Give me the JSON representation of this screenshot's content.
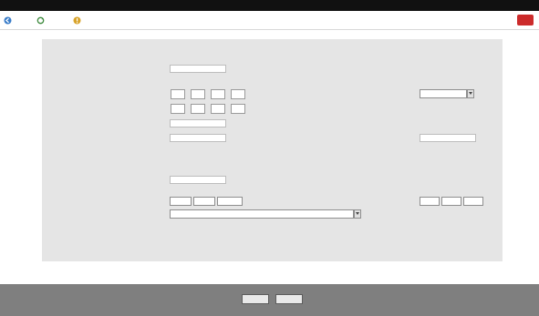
{
  "window": {
    "title": ""
  },
  "toolbar": {
    "items": [
      {
        "label": "",
        "icon": "back-icon"
      },
      {
        "label": "",
        "icon": "refresh-icon"
      },
      {
        "label": "",
        "icon": "help-icon"
      }
    ],
    "brand_color": "#cc2b2b"
  },
  "form": {
    "section1": {
      "title": "",
      "row1": {
        "label": "",
        "value": ""
      },
      "row2": {
        "label": "",
        "value": ""
      },
      "row3": {
        "label": "",
        "right_label": "",
        "right_value": ""
      },
      "row4": {
        "label": ""
      },
      "row5": {
        "label": "",
        "value": ""
      },
      "row6": {
        "label": "",
        "value": "",
        "right_label": "",
        "right_value": ""
      }
    },
    "section2": {
      "title": "",
      "row1": {
        "label": "",
        "value": ""
      },
      "row2": {
        "label": "",
        "values": [
          "",
          "",
          ""
        ],
        "right_label": "",
        "right_values": [
          "",
          "",
          ""
        ]
      },
      "row3": {
        "label": "",
        "value": ""
      },
      "row4": {
        "label": "",
        "value": ""
      }
    }
  },
  "footer": {
    "ok_label": "",
    "cancel_label": ""
  },
  "colors": {
    "title_bar": "#111111",
    "panel": "#e5e5e5",
    "footer": "#7f7f7f",
    "accent": "#cc2b2b"
  }
}
